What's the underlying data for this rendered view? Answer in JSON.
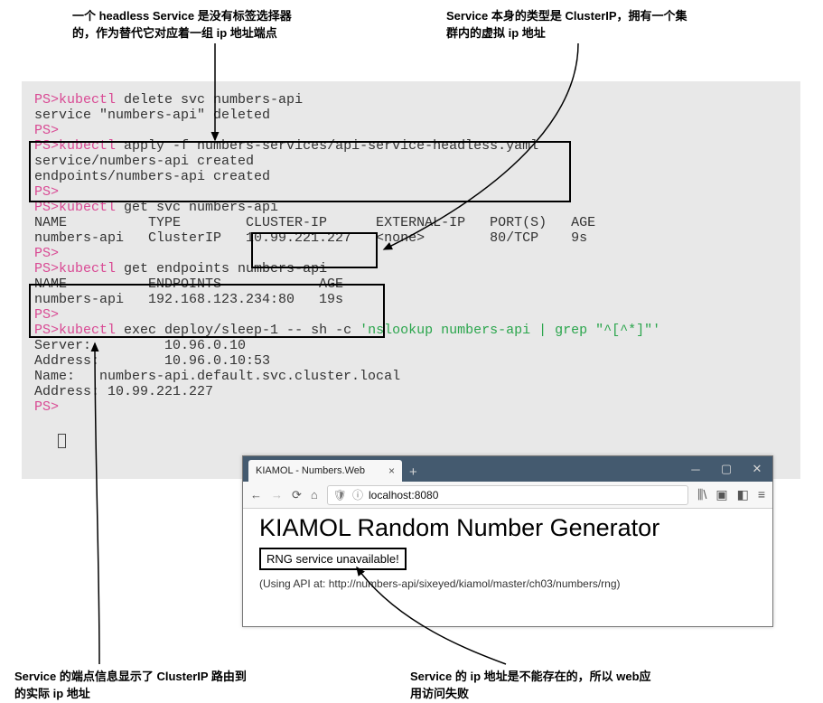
{
  "labels": {
    "topLeft": "一个 headless Service 是没有标签选择器\n的，作为替代它对应着一组 ip 地址端点",
    "topRight": "Service 本身的类型是 ClusterIP，拥有一个集\n群内的虚拟 ip 地址",
    "bottomLeft": "Service 的端点信息显示了 ClusterIP 路由到\n的实际 ip 地址",
    "bottomRight": "Service 的 ip 地址是不能存在的，所以 web应\n用访问失败"
  },
  "terminal": {
    "lines": [
      {
        "ps": "PS>",
        "cmd": "kubectl",
        "rest": " delete svc numbers-api"
      },
      {
        "plain": "service \"numbers-api\" deleted"
      },
      {
        "ps": "PS>"
      },
      {
        "ps": "PS>",
        "cmd": "kubectl",
        "rest": " apply -f numbers-services/api-service-headless.yaml"
      },
      {
        "plain": "service/numbers-api created"
      },
      {
        "plain": "endpoints/numbers-api created"
      },
      {
        "ps": "PS>"
      },
      {
        "ps": "PS>",
        "cmd": "kubectl",
        "rest": " get svc numbers-api"
      },
      {
        "plain": "NAME          TYPE        CLUSTER-IP      EXTERNAL-IP   PORT(S)   AGE"
      },
      {
        "plain": "numbers-api   ClusterIP   10.99.221.227   <none>        80/TCP    9s"
      },
      {
        "ps": "PS>"
      },
      {
        "ps": "PS>",
        "cmd": "kubectl",
        "rest": " get endpoints numbers-api"
      },
      {
        "plain": "NAME          ENDPOINTS            AGE"
      },
      {
        "plain": "numbers-api   192.168.123.234:80   19s"
      },
      {
        "ps": "PS>"
      },
      {
        "ps": "PS>",
        "cmd": "kubectl",
        "rest": " exec deploy/sleep-1 -- sh -c ",
        "grn": "'nslookup numbers-api | grep \"^[^*]\"'"
      },
      {
        "plain": "Server:         10.96.0.10"
      },
      {
        "plain": "Address:        10.96.0.10:53"
      },
      {
        "plain": "Name:   numbers-api.default.svc.cluster.local"
      },
      {
        "plain": "Address: 10.99.221.227"
      },
      {
        "ps": "PS>"
      }
    ]
  },
  "browser": {
    "tabTitle": "KIAMOL - Numbers.Web",
    "url": "localhost:8080",
    "h1": "KIAMOL Random Number Generator",
    "rngStatus": "RNG service unavailable!",
    "apiLine": "(Using API at: http://numbers-api/sixeyed/kiamol/master/ch03/numbers/rng)"
  }
}
